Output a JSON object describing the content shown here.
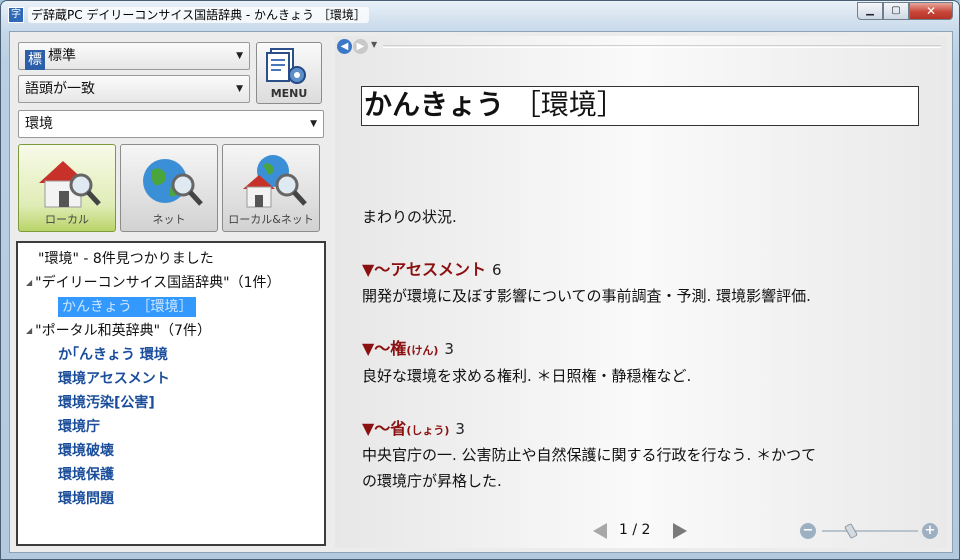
{
  "window": {
    "title": "デ辞蔵PC デイリーコンサイス国語辞典 - かんきょう ［環境］",
    "app_icon": "dictionary-app-icon",
    "controls": {
      "minimize": "minimize-icon",
      "maximize": "maximize-icon",
      "close": "close-icon"
    }
  },
  "search": {
    "dictionary_set": {
      "badge": "標",
      "value": "標準"
    },
    "match_mode": "語頭が一致",
    "query": "環境",
    "menu_label": "MENU"
  },
  "sources": [
    {
      "label": "ローカル",
      "icon": "house-magnifier-icon",
      "active": true
    },
    {
      "label": "ネット",
      "icon": "globe-magnifier-icon",
      "active": false
    },
    {
      "label": "ローカル&ネット",
      "icon": "house-globe-magnifier-icon",
      "active": false
    }
  ],
  "results": {
    "summary": "\"環境\" - 8件見つかりました",
    "groups": [
      {
        "label": "\"デイリーコンサイス国語辞典\"（1件）",
        "items": [
          "かんきょう ［環境］"
        ]
      },
      {
        "label": "\"ポータル和英辞典\"（7件）",
        "items": [
          "か｢んきょう 環境",
          "環境アセスメント",
          "環境汚染[公害]",
          "環境庁",
          "環境破壊",
          "環境保護",
          "環境問題"
        ]
      }
    ]
  },
  "entry": {
    "headword": "かんきょう",
    "headword_kanji": "［環境］",
    "definition": "まわりの状況.",
    "subentries": [
      {
        "term": "▼～アセスメント",
        "reading": "",
        "number": "6",
        "text": [
          "開発が環境に及ぼす影響についての事前調査・予測.  環境影響評価."
        ]
      },
      {
        "term": "▼～権",
        "reading": "(けん)",
        "number": "3",
        "text": [
          "良好な環境を求める権利.   ＊日照権・静穏権など."
        ]
      },
      {
        "term": "▼～省",
        "reading": "(しょう)",
        "number": "3",
        "text": [
          "中央官庁の一.  公害防止や自然保護に関する行政を行なう.    ＊かつて",
          "の環境庁が昇格した."
        ]
      }
    ]
  },
  "pager": {
    "current": "1",
    "separator": "/",
    "total": "2"
  },
  "zoom": {
    "level": 0.3
  },
  "colors": {
    "subentry": "#8b1010",
    "result_link": "#1a4d9c",
    "selection": "#3399ff"
  }
}
